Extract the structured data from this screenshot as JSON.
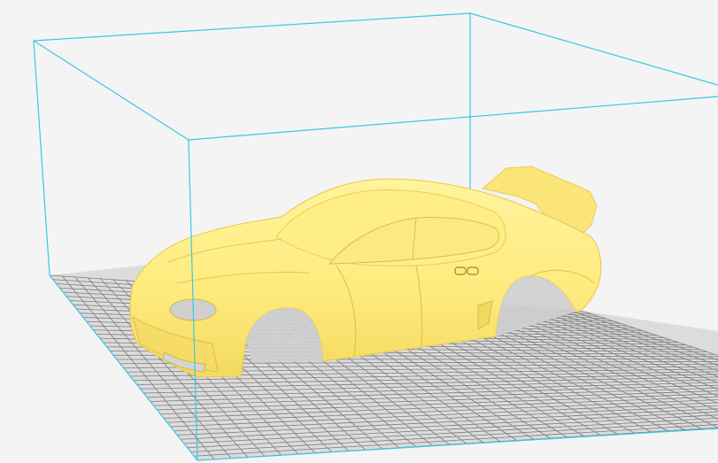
{
  "viewport": {
    "background_color": "#f4f4f4",
    "build_volume_color": "#38c8e4",
    "build_plate_color": "#dcdcdc",
    "build_plate_grid_color": "#7c7c7c",
    "model_color": "#ffeb7e",
    "model_shade_color": "#f3d95f",
    "model_highlight_color": "#fff49d"
  },
  "model": {
    "name": "",
    "emblem_text": ""
  }
}
